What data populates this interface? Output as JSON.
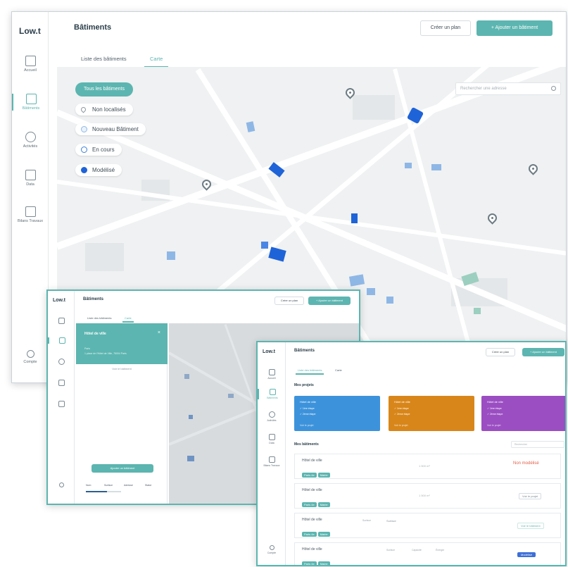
{
  "app": {
    "logo": "Low.t"
  },
  "main": {
    "title": "Bâtiments",
    "import_label": "Créer un plan",
    "add_label": "+ Ajouter un bâtiment",
    "tabs": [
      {
        "label": "Liste des bâtiments",
        "selected": false
      },
      {
        "label": "Carte",
        "selected": true
      }
    ],
    "sidebar": [
      {
        "label": "Accueil",
        "icon": "dashboard-icon",
        "active": false
      },
      {
        "label": "Bâtiments",
        "icon": "building-icon",
        "active": true
      },
      {
        "label": "Activités",
        "icon": "activity-icon",
        "active": false
      },
      {
        "label": "Data",
        "icon": "data-icon",
        "active": false
      },
      {
        "label": "Bilans Travaux",
        "icon": "report-icon",
        "active": false
      }
    ],
    "sidebar_footer": "Compte",
    "map": {
      "filter_button": "Tous les bâtiments",
      "search_placeholder": "Rechercher une adresse",
      "legend": [
        {
          "label": "Non localisés",
          "color": "#8a969d",
          "style": "pin"
        },
        {
          "label": "Nouveau Bâtiment",
          "color": "#cfe3f4",
          "style": "ring"
        },
        {
          "label": "En cours",
          "color": "#7fb2e3",
          "style": "ring"
        },
        {
          "label": "Modélisé",
          "color": "#1f63d8",
          "style": "fill"
        }
      ]
    }
  },
  "window_b": {
    "logo": "Low.t",
    "title": "Bâtiments",
    "import_label": "Créer un plan",
    "add_label": "+ Ajouter un bâtiment",
    "tabs": [
      "Liste des bâtiments",
      "Carte"
    ],
    "panel": {
      "heading": "Hôtel de ville",
      "lines": [
        "Paris",
        "1 place de l'Hôtel de Ville, 75004 Paris"
      ],
      "close_icon": "close-icon",
      "sub_action": "Voir le bâtiment",
      "cta": "Ajouter un bâtiment",
      "footer_labels": [
        "Nom",
        "Surface",
        "Adresse",
        "Statut"
      ]
    }
  },
  "window_c": {
    "logo": "Low.t",
    "title": "Bâtiments",
    "import_label": "Créer un plan",
    "add_label": "+ Ajouter un bâtiment",
    "tabs": [
      "Liste des bâtiments",
      "Carte"
    ],
    "section_projects": "Mes projets",
    "cards": [
      {
        "title": "Hôtel de ville",
        "lines": [
          "✓ 1ère étape",
          "✓ 2ème étape"
        ],
        "footer": "Voir le projet",
        "color": "#3d93db"
      },
      {
        "title": "Hôtel de ville",
        "lines": [
          "✓ 1ère étape",
          "✓ 2ème étape"
        ],
        "footer": "Voir le projet",
        "color": "#d8861a"
      },
      {
        "title": "Hôtel de ville",
        "lines": [
          "✓ 1ère étape",
          "✓ 2ème étape"
        ],
        "footer": "Voir le projet",
        "color": "#9b4ec2"
      }
    ],
    "section_buildings": "Mes bâtiments",
    "search_placeholder": "Rechercher",
    "rows": [
      {
        "name": "Hôtel de ville",
        "tags": [
          "Paris 4e",
          "Mairie"
        ],
        "center": "1 500 m²",
        "status": "Non modélisé",
        "status_color": "#e2604b"
      },
      {
        "name": "Hôtel de ville",
        "tags": [
          "Paris 4e",
          "Mairie"
        ],
        "center": "1 500 m²",
        "status": "Voir le projet",
        "status_color": "#7a8891"
      },
      {
        "name": "Hôtel de ville",
        "tags": [
          "Paris 4e",
          "Mairie"
        ],
        "center": "Surface",
        "status": "Voir le bâtiment",
        "status_color": "#5cb5b0"
      },
      {
        "name": "Hôtel de ville",
        "tags": [
          "Paris 4e",
          "Mairie"
        ],
        "center": "Surface",
        "status": "Modélisé",
        "status_color": "#3d6fd8"
      }
    ],
    "row_meta": [
      "Surface",
      "Capacité",
      "Énergie"
    ],
    "sidebar": [
      "Accueil",
      "Bâtiments",
      "Activités",
      "Data",
      "Bilans Travaux"
    ],
    "sidebar_footer": "Compte"
  },
  "colors": {
    "accent": "#5cb5b0",
    "building": "#1f63d8",
    "building_light": "#8fb7e6",
    "park_green": "#9ccfbf"
  }
}
